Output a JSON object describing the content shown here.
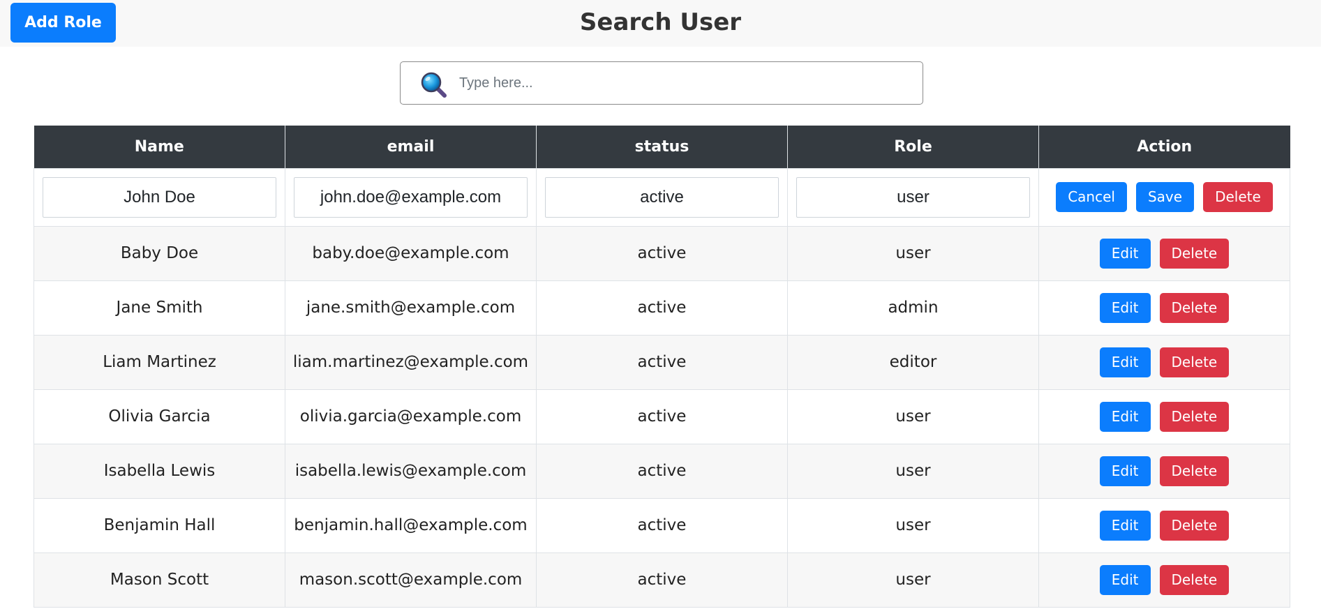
{
  "header": {
    "add_role_label": "Add Role",
    "title": "Search User"
  },
  "search": {
    "placeholder": "Type here...",
    "value": ""
  },
  "table": {
    "columns": [
      "Name",
      "email",
      "status",
      "Role",
      "Action"
    ],
    "edit_row": {
      "name": "John Doe",
      "email": "john.doe@example.com",
      "status": "active",
      "role": "user",
      "actions": {
        "cancel": "Cancel",
        "save": "Save",
        "delete": "Delete"
      }
    },
    "rows": [
      {
        "name": "Baby Doe",
        "email": "baby.doe@example.com",
        "status": "active",
        "role": "user"
      },
      {
        "name": "Jane Smith",
        "email": "jane.smith@example.com",
        "status": "active",
        "role": "admin"
      },
      {
        "name": "Liam Martinez",
        "email": "liam.martinez@example.com",
        "status": "active",
        "role": "editor"
      },
      {
        "name": "Olivia Garcia",
        "email": "olivia.garcia@example.com",
        "status": "active",
        "role": "user"
      },
      {
        "name": "Isabella Lewis",
        "email": "isabella.lewis@example.com",
        "status": "active",
        "role": "user"
      },
      {
        "name": "Benjamin Hall",
        "email": "benjamin.hall@example.com",
        "status": "active",
        "role": "user"
      },
      {
        "name": "Mason Scott",
        "email": "mason.scott@example.com",
        "status": "active",
        "role": "user"
      }
    ],
    "row_actions": {
      "edit": "Edit",
      "delete": "Delete"
    }
  },
  "colors": {
    "primary": "#0b7dfd",
    "danger": "#dc3545",
    "header_bg": "#343a40"
  },
  "icons": {
    "search": "search-icon"
  }
}
